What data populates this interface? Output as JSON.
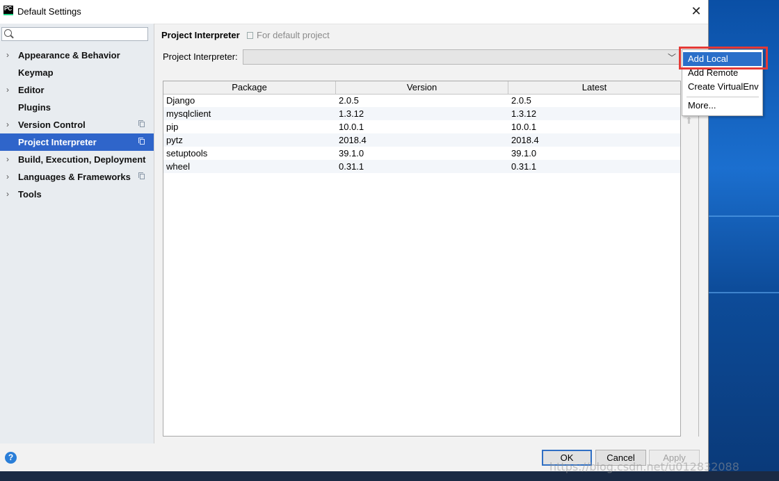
{
  "window": {
    "title": "Default Settings",
    "app_icon_text": "PC"
  },
  "search": {
    "placeholder": ""
  },
  "sidebar": {
    "items": [
      {
        "label": "Appearance & Behavior",
        "expandable": true,
        "copy_icon": false,
        "selected": false
      },
      {
        "label": "Keymap",
        "expandable": false,
        "copy_icon": false,
        "selected": false
      },
      {
        "label": "Editor",
        "expandable": true,
        "copy_icon": false,
        "selected": false
      },
      {
        "label": "Plugins",
        "expandable": false,
        "copy_icon": false,
        "selected": false
      },
      {
        "label": "Version Control",
        "expandable": true,
        "copy_icon": true,
        "selected": false
      },
      {
        "label": "Project Interpreter",
        "expandable": false,
        "copy_icon": true,
        "selected": true
      },
      {
        "label": "Build, Execution, Deployment",
        "expandable": true,
        "copy_icon": false,
        "selected": false
      },
      {
        "label": "Languages & Frameworks",
        "expandable": true,
        "copy_icon": true,
        "selected": false
      },
      {
        "label": "Tools",
        "expandable": true,
        "copy_icon": false,
        "selected": false
      }
    ]
  },
  "main": {
    "title": "Project Interpreter",
    "subtitle": "For default project",
    "interpreter_label": "Project Interpreter:",
    "interpreter_value": ""
  },
  "table": {
    "columns": [
      "Package",
      "Version",
      "Latest"
    ],
    "rows": [
      [
        "Django",
        "2.0.5",
        "2.0.5"
      ],
      [
        "mysqlclient",
        "1.3.12",
        "1.3.12"
      ],
      [
        "pip",
        "10.0.1",
        "10.0.1"
      ],
      [
        "pytz",
        "2018.4",
        "2018.4"
      ],
      [
        "setuptools",
        "39.1.0",
        "39.1.0"
      ],
      [
        "wheel",
        "0.31.1",
        "0.31.1"
      ]
    ]
  },
  "popup_menu": {
    "items": [
      "Add Local",
      "Add Remote",
      "Create VirtualEnv",
      "More..."
    ],
    "active_index": 0
  },
  "buttons": {
    "ok": "OK",
    "cancel": "Cancel",
    "apply": "Apply",
    "help": "?"
  },
  "watermark": "https://blog.csdn.net/u012832088",
  "colors": {
    "selection": "#2f65ca",
    "highlight_box": "#e53935",
    "menu_active": "#2a6fc9"
  }
}
